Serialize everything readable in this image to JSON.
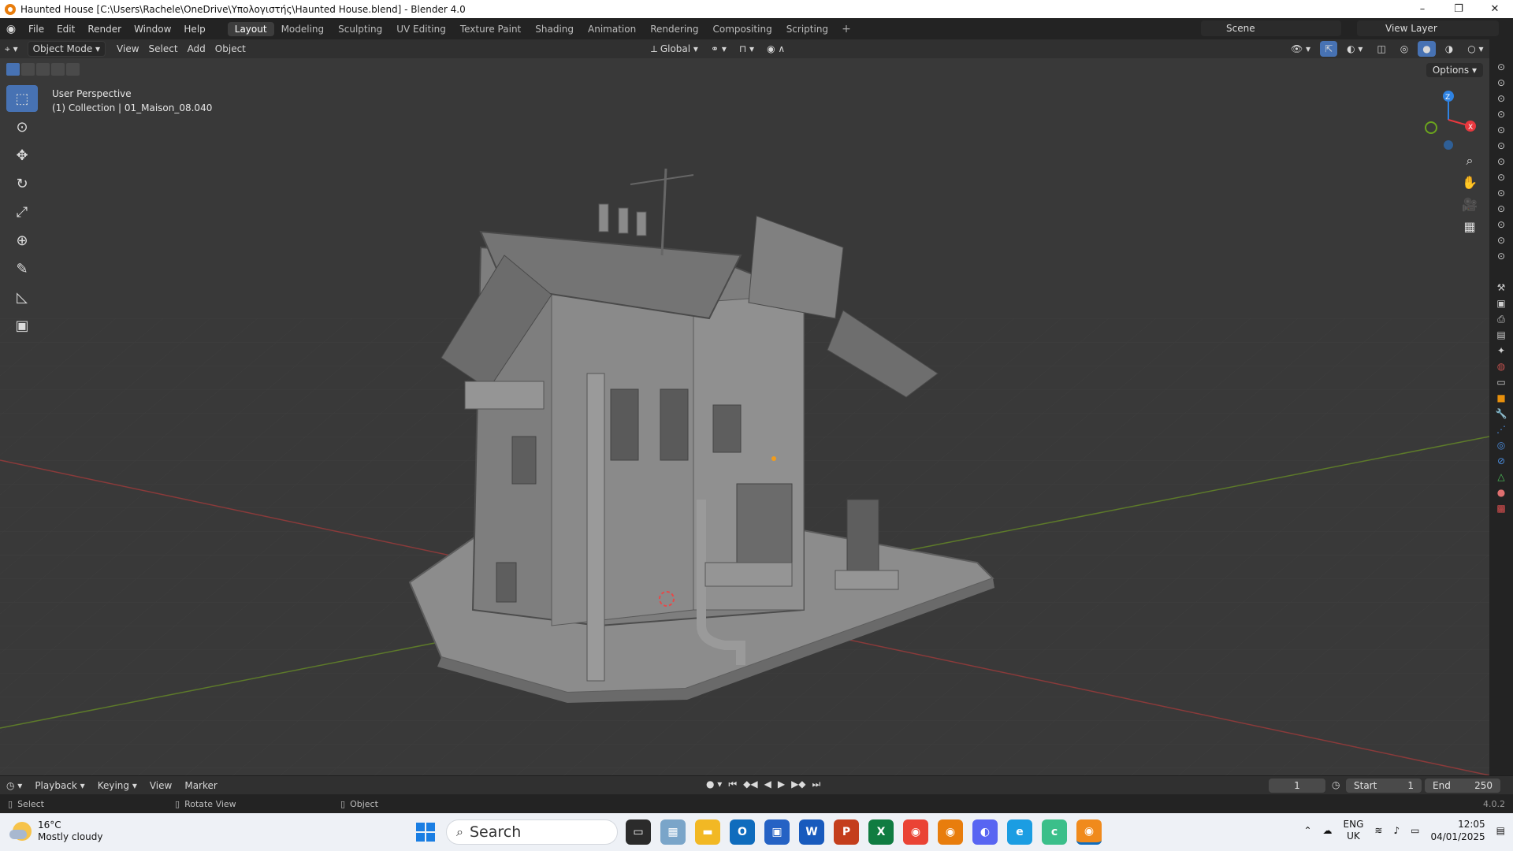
{
  "window": {
    "title": "Haunted House [C:\\Users\\Rachele\\OneDrive\\Υπολογιστής\\Haunted House.blend] - Blender 4.0",
    "controls": [
      "–",
      "❐",
      "✕"
    ]
  },
  "menu": [
    "File",
    "Edit",
    "Render",
    "Window",
    "Help"
  ],
  "workspaces": {
    "tabs": [
      "Layout",
      "Modeling",
      "Sculpting",
      "UV Editing",
      "Texture Paint",
      "Shading",
      "Animation",
      "Rendering",
      "Compositing",
      "Scripting"
    ],
    "active": "Layout",
    "add_label": "+"
  },
  "scene": {
    "label": "Scene"
  },
  "view_layer": {
    "label": "View Layer"
  },
  "header": {
    "mode": "Object Mode",
    "menus": [
      "View",
      "Select",
      "Add",
      "Object"
    ],
    "orientation": "Global"
  },
  "viewport": {
    "perspective": "User Perspective",
    "collection": "(1) Collection | 01_Maison_08.040",
    "options": "Options",
    "gizmo": {
      "z": "Z",
      "x": "X",
      "z_color": "#2f83e3",
      "x_color": "#e8383e",
      "y_color": "#6ba41d"
    }
  },
  "tools": [
    {
      "name": "select-box-tool",
      "icon": "⬚",
      "active": true
    },
    {
      "name": "cursor-tool",
      "icon": "⊙",
      "active": false
    },
    {
      "name": "move-tool",
      "icon": "✥",
      "active": false
    },
    {
      "name": "rotate-tool",
      "icon": "↻",
      "active": false
    },
    {
      "name": "scale-tool",
      "icon": "⤢",
      "active": false
    },
    {
      "name": "transform-tool",
      "icon": "⊕",
      "active": false
    },
    {
      "name": "annotate-tool",
      "icon": "✎",
      "active": false
    },
    {
      "name": "measure-tool",
      "icon": "📐",
      "active": false
    },
    {
      "name": "add-cube-tool",
      "icon": "▣",
      "active": false
    }
  ],
  "timeline": {
    "menus": [
      "Playback",
      "Keying",
      "View",
      "Marker"
    ],
    "current_frame": "1",
    "start_label": "Start",
    "start_value": "1",
    "end_label": "End",
    "end_value": "250"
  },
  "status": {
    "select": "Select",
    "rotate": "Rotate View",
    "object": "Object",
    "version": "4.0.2"
  },
  "taskbar": {
    "temperature": "16°C",
    "weather": "Mostly cloudy",
    "search_placeholder": "Search",
    "lang_top": "ENG",
    "lang_bottom": "UK",
    "time": "12:05",
    "date": "04/01/2025"
  }
}
